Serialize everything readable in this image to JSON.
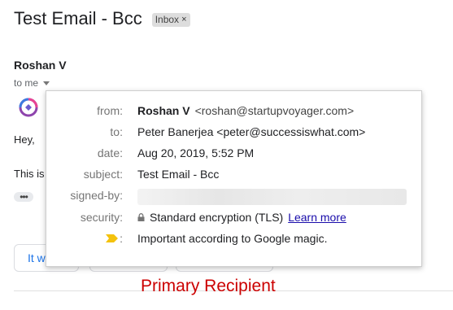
{
  "email": {
    "subject": "Test Email - Bcc",
    "label_chip": "Inbox",
    "label_remove": "×",
    "sender_name": "Roshan V",
    "to_line": "to me",
    "greeting": "Hey,",
    "body_partial": "This is",
    "more_button": "•••",
    "reply_suggestion": "It w"
  },
  "details": {
    "from_label": "from:",
    "from_name": "Roshan V",
    "from_email": "<roshan@startupvoyager.com>",
    "to_label": "to:",
    "to_value": "Peter Banerjea <peter@successiswhat.com>",
    "date_label": "date:",
    "date_value": "Aug 20, 2019, 5:52 PM",
    "subject_label": "subject:",
    "subject_value": "Test Email - Bcc",
    "signed_label": "signed-by:",
    "security_label": "security:",
    "security_value": "Standard encryption (TLS)",
    "learn_more": "Learn more",
    "importance_colon": ":",
    "importance_value": "Important according to Google magic."
  },
  "annotation": "Primary Recipient",
  "colors": {
    "annotation": "#cc0000",
    "importance_marker": "#f4c20d",
    "link": "#1a0dab"
  },
  "icons": [
    "dropdown-arrow-icon",
    "avatar-icon",
    "lock-icon",
    "importance-marker-icon"
  ]
}
